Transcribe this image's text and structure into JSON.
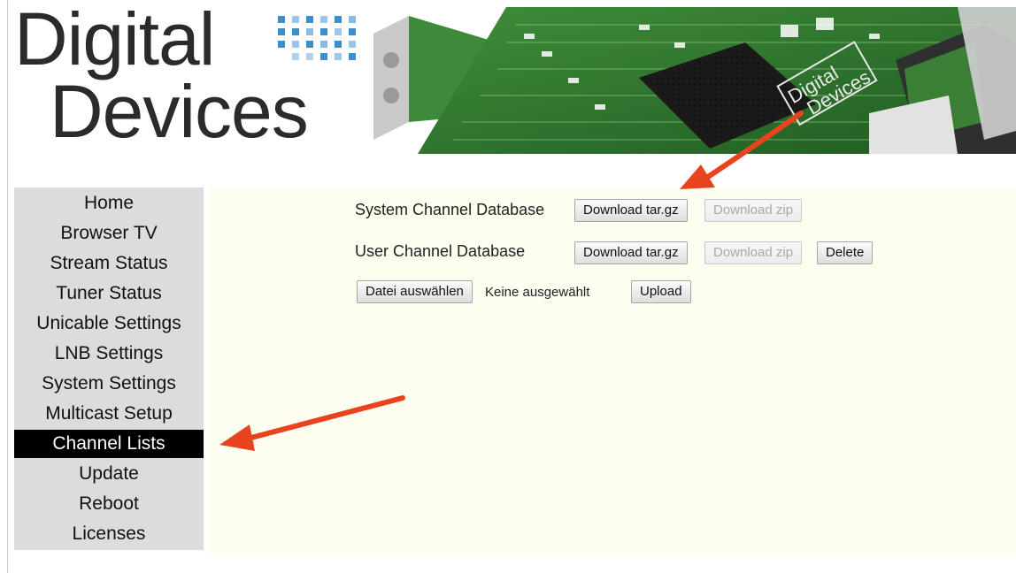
{
  "logo": {
    "line1": "Digital",
    "line2": "Devices"
  },
  "banner": {
    "board_text_line1": "Digital",
    "board_text_line2": "Devices"
  },
  "nav": {
    "items": [
      {
        "label": "Home"
      },
      {
        "label": "Browser TV"
      },
      {
        "label": "Stream Status"
      },
      {
        "label": "Tuner Status"
      },
      {
        "label": "Unicable Settings"
      },
      {
        "label": "LNB Settings"
      },
      {
        "label": "System Settings"
      },
      {
        "label": "Multicast Setup"
      },
      {
        "label": "Channel Lists"
      },
      {
        "label": "Update"
      },
      {
        "label": "Reboot"
      },
      {
        "label": "Licenses"
      }
    ],
    "active": "Channel Lists"
  },
  "main": {
    "system_db": {
      "label": "System Channel Database",
      "download_targz": "Download tar.gz",
      "download_zip": "Download zip"
    },
    "user_db": {
      "label": "User Channel Database",
      "download_targz": "Download tar.gz",
      "download_zip": "Download zip",
      "delete": "Delete"
    },
    "upload": {
      "choose_file": "Datei auswählen",
      "file_status": "Keine ausgewählt",
      "upload": "Upload"
    }
  },
  "colors": {
    "active_nav_bg": "#000000",
    "nav_bg": "#dcdcdc",
    "main_bg": "#fdfdf0",
    "annotation_arrow": "#e8431f",
    "logo_dots": "#3a8fcf"
  }
}
